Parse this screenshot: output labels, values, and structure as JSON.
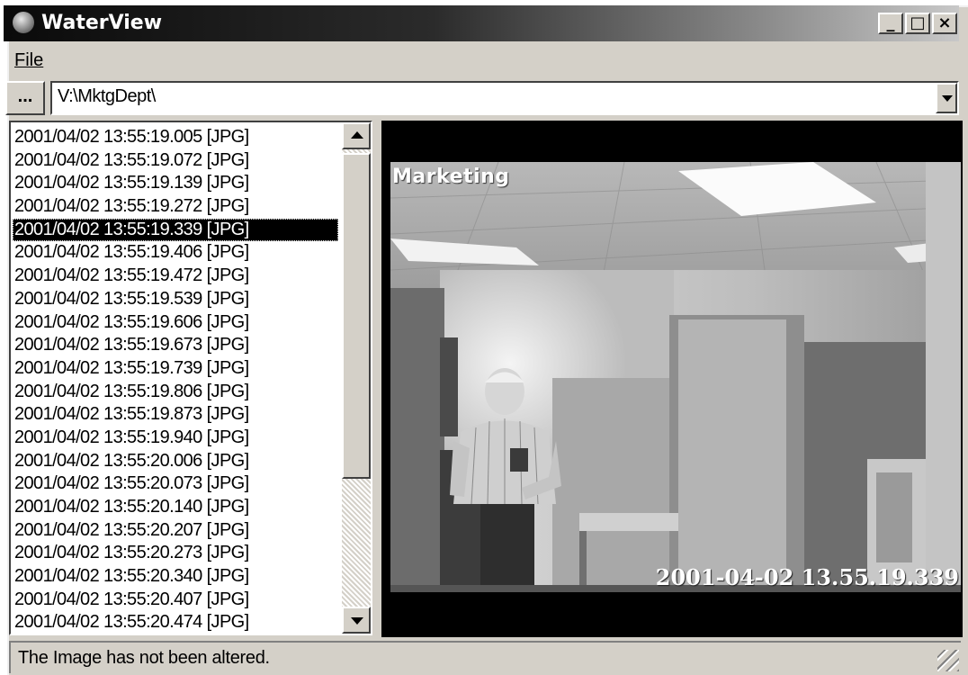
{
  "window": {
    "title": "WaterView"
  },
  "title_buttons": {
    "minimize": "_",
    "maximize": "□",
    "close": "×"
  },
  "menu": {
    "file_label": "File"
  },
  "toolbar": {
    "browse_label": "...",
    "path_value": "V:\\MktgDept\\"
  },
  "file_list": {
    "selected_index": 4,
    "items": [
      "2001/04/02 13:55:19.005 [JPG]",
      "2001/04/02 13:55:19.072 [JPG]",
      "2001/04/02 13:55:19.139 [JPG]",
      "2001/04/02 13:55:19.272 [JPG]",
      "2001/04/02 13:55:19.339 [JPG]",
      "2001/04/02 13:55:19.406 [JPG]",
      "2001/04/02 13:55:19.472 [JPG]",
      "2001/04/02 13:55:19.539 [JPG]",
      "2001/04/02 13:55:19.606 [JPG]",
      "2001/04/02 13:55:19.673 [JPG]",
      "2001/04/02 13:55:19.739 [JPG]",
      "2001/04/02 13:55:19.806 [JPG]",
      "2001/04/02 13:55:19.873 [JPG]",
      "2001/04/02 13:55:19.940 [JPG]",
      "2001/04/02 13:55:20.006 [JPG]",
      "2001/04/02 13:55:20.073 [JPG]",
      "2001/04/02 13:55:20.140 [JPG]",
      "2001/04/02 13:55:20.207 [JPG]",
      "2001/04/02 13:55:20.273 [JPG]",
      "2001/04/02 13:55:20.340 [JPG]",
      "2001/04/02 13:55:20.407 [JPG]",
      "2001/04/02 13:55:20.474 [JPG]"
    ]
  },
  "viewer": {
    "camera_label": "Marketing",
    "overlay_timestamp": "2001-04-02 13.55.19.339"
  },
  "status": {
    "text": "The Image has not been altered."
  }
}
